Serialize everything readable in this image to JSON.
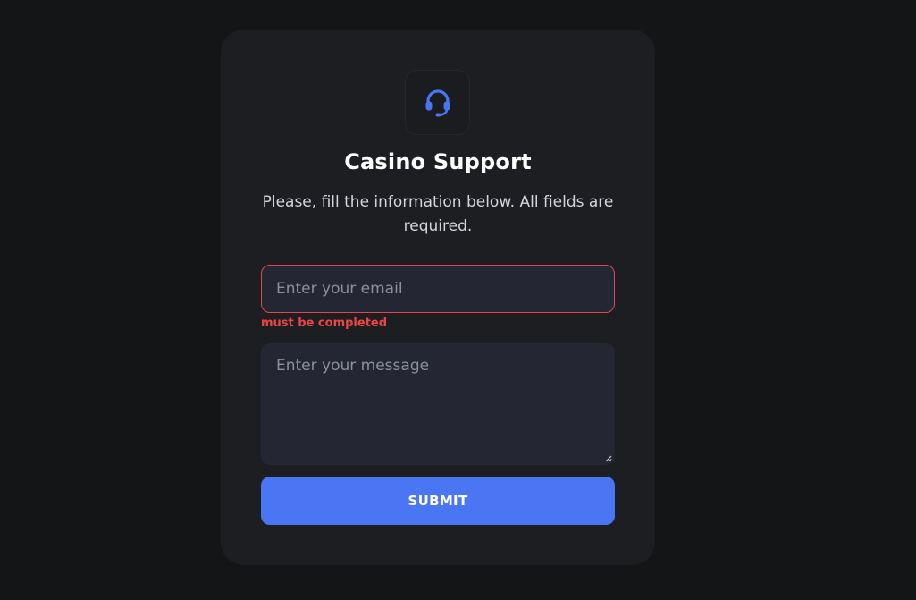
{
  "card": {
    "icon": "headset-icon",
    "title": "Casino Support",
    "subtitle": "Please, fill the information below. All fields are required."
  },
  "form": {
    "email_placeholder": "Enter your email",
    "email_value": "",
    "email_error": "must be completed",
    "message_placeholder": "Enter your message",
    "message_value": "",
    "submit_label": "SUBMIT"
  },
  "colors": {
    "accent": "#4a76f3",
    "error": "#ef4444",
    "background": "#141517",
    "card": "#1c1e22"
  }
}
